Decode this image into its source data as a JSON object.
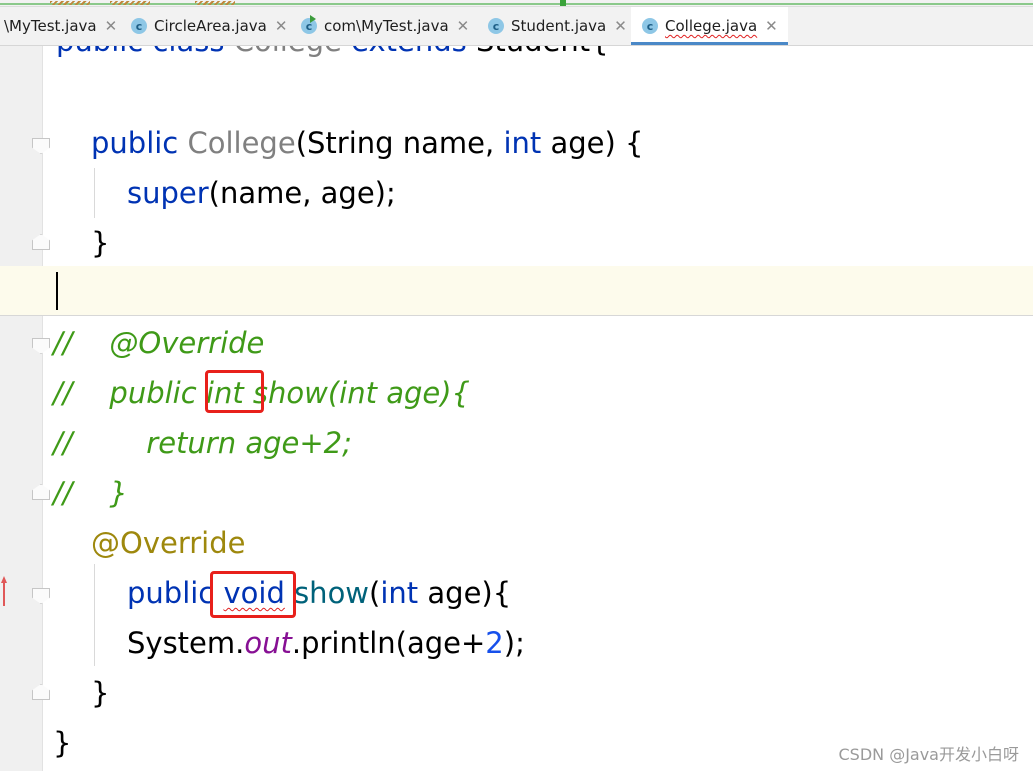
{
  "tabs": [
    {
      "label": "\\MyTest.java",
      "icon": "java-class-icon"
    },
    {
      "label": "CircleArea.java",
      "icon": "java-class-icon"
    },
    {
      "label": "com\\MyTest.java",
      "icon": "java-runnable-class-icon"
    },
    {
      "label": "Student.java",
      "icon": "java-class-icon"
    },
    {
      "label": "College.java",
      "icon": "java-class-icon",
      "active": true
    }
  ],
  "colors": {
    "keyword": "#0033b3",
    "comment": "#3f9a18",
    "annotation": "#9e880d",
    "static_field": "#871094",
    "number": "#1750eb",
    "highlight_box": "#e8201b",
    "active_tab_underline": "#4a88c7"
  },
  "code": {
    "l0": {
      "kw1": "public",
      "kw2": "class",
      "name": "College",
      "kw3": "extends",
      "rest": "Student{"
    },
    "l2": {
      "kw": "public",
      "name": "College",
      "p1": "(String name, ",
      "kw2": "int",
      "p2": " age) {"
    },
    "l3": {
      "kw": "super",
      "rest": "(name, age);"
    },
    "l4": {
      "text": "}"
    },
    "l6": {
      "text": "//    @Override"
    },
    "l7": {
      "a": "//    public ",
      "b": "int",
      "c": " show(int age){"
    },
    "l8": {
      "text": "//        return age+2;"
    },
    "l9": {
      "text": "//    }"
    },
    "l10": {
      "text": "@Override"
    },
    "l11": {
      "kw": "public",
      "kw2": "void",
      "meth": "show",
      "p1": "(",
      "kw3": "int",
      "p2": " age){"
    },
    "l12": {
      "a": "System.",
      "fld": "out",
      "b": ".println(age+",
      "num": "2",
      "c": ");"
    },
    "l13": {
      "text": "}"
    },
    "l14": {
      "text": "}"
    }
  },
  "watermark": "CSDN @Java开发小白呀"
}
